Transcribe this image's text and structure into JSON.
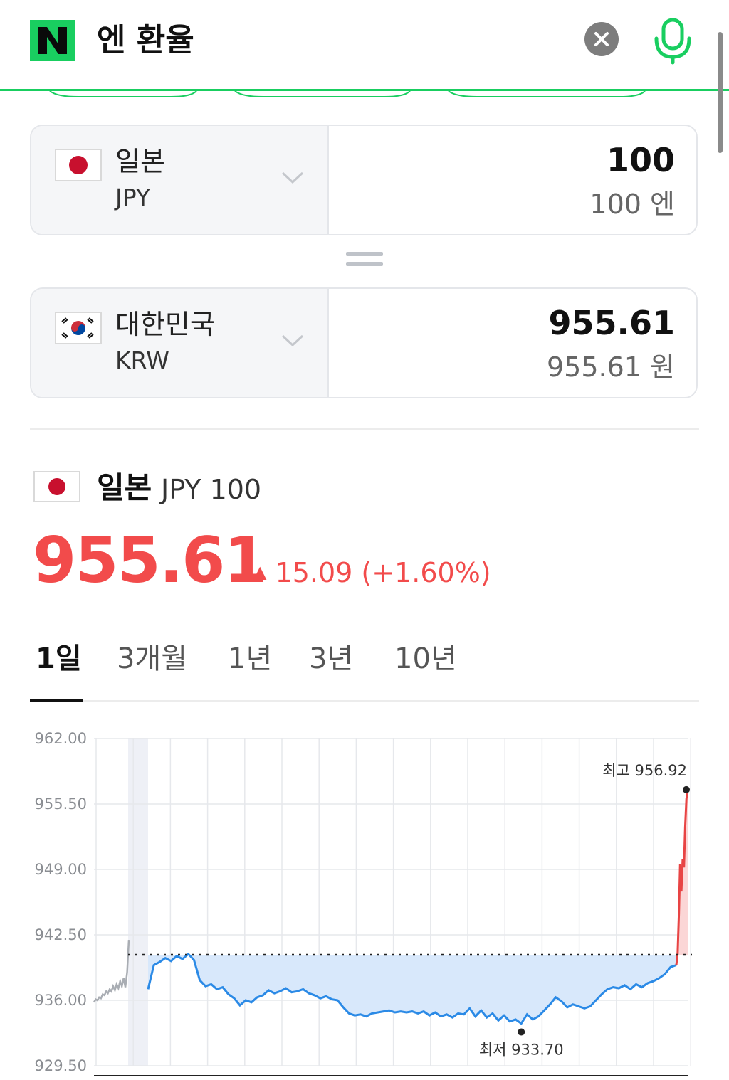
{
  "header": {
    "query": "엔 환율"
  },
  "converter": {
    "from": {
      "name": "일본",
      "code": "JPY",
      "amount": "100",
      "amount_text": "100 엔"
    },
    "to": {
      "name": "대한민국",
      "code": "KRW",
      "amount": "955.61",
      "amount_text": "955.61 원"
    }
  },
  "info": {
    "country": "일본",
    "unit": "JPY 100",
    "price": "955.61",
    "change": "15.09 (+1.60%)",
    "change_arrow": "▲"
  },
  "tabs": [
    {
      "label": "1일",
      "active": true
    },
    {
      "label": "3개월",
      "active": false
    },
    {
      "label": "1년",
      "active": false
    },
    {
      "label": "3년",
      "active": false
    },
    {
      "label": "10년",
      "active": false
    }
  ],
  "chart_data": {
    "type": "line",
    "yticks": [
      "962.00",
      "955.50",
      "949.00",
      "942.50",
      "936.00",
      "929.50"
    ],
    "ylim": [
      929.5,
      962.0
    ],
    "reference_line": 940.52,
    "high_label": "최고 956.92",
    "low_label": "최저 933.70",
    "high": 956.92,
    "low": 933.7,
    "grid": true,
    "series": [
      {
        "segment": "pre",
        "values": [
          935.8,
          936.1,
          936.0,
          936.3,
          936.2,
          936.6,
          936.5,
          936.9,
          936.7,
          937.1,
          936.9,
          937.4,
          937.0,
          937.6,
          937.2,
          937.9,
          937.4,
          938.2,
          937.3,
          938.8,
          942.0
        ]
      },
      {
        "segment": "main",
        "values": [
          937.1,
          939.5,
          939.8,
          940.2,
          939.9,
          940.4,
          940.1,
          940.6,
          940.0,
          938.0,
          937.4,
          937.6,
          937.1,
          937.3,
          936.6,
          936.2,
          935.5,
          936.0,
          935.8,
          936.3,
          936.5,
          937.0,
          936.7,
          936.9,
          937.2,
          936.8,
          936.9,
          937.1,
          936.7,
          936.5,
          936.2,
          936.4,
          936.1,
          936.0,
          935.3,
          934.7,
          934.5,
          934.6,
          934.4,
          934.7,
          934.8,
          934.9,
          935.0,
          934.8,
          934.9,
          934.8,
          934.9,
          934.7,
          934.9,
          934.5,
          934.8,
          934.4,
          934.6,
          934.3,
          934.7,
          934.6,
          935.2,
          934.4,
          935.0,
          934.3,
          934.7,
          934.0,
          934.5,
          933.9,
          934.1,
          933.7,
          934.6,
          934.1,
          934.4,
          935.0,
          935.6,
          936.3,
          935.9,
          935.3,
          935.6,
          935.4,
          935.2,
          935.4,
          936.0,
          936.6,
          937.1,
          937.3,
          937.2,
          937.5,
          937.1,
          937.6,
          937.3,
          937.7,
          937.9,
          938.2,
          938.6,
          939.3,
          939.5
        ]
      },
      {
        "segment": "rise",
        "values": [
          939.5,
          940.6,
          944.5,
          949.5,
          946.8,
          950.0,
          949.2,
          953.2,
          956.0,
          956.92
        ]
      }
    ]
  }
}
